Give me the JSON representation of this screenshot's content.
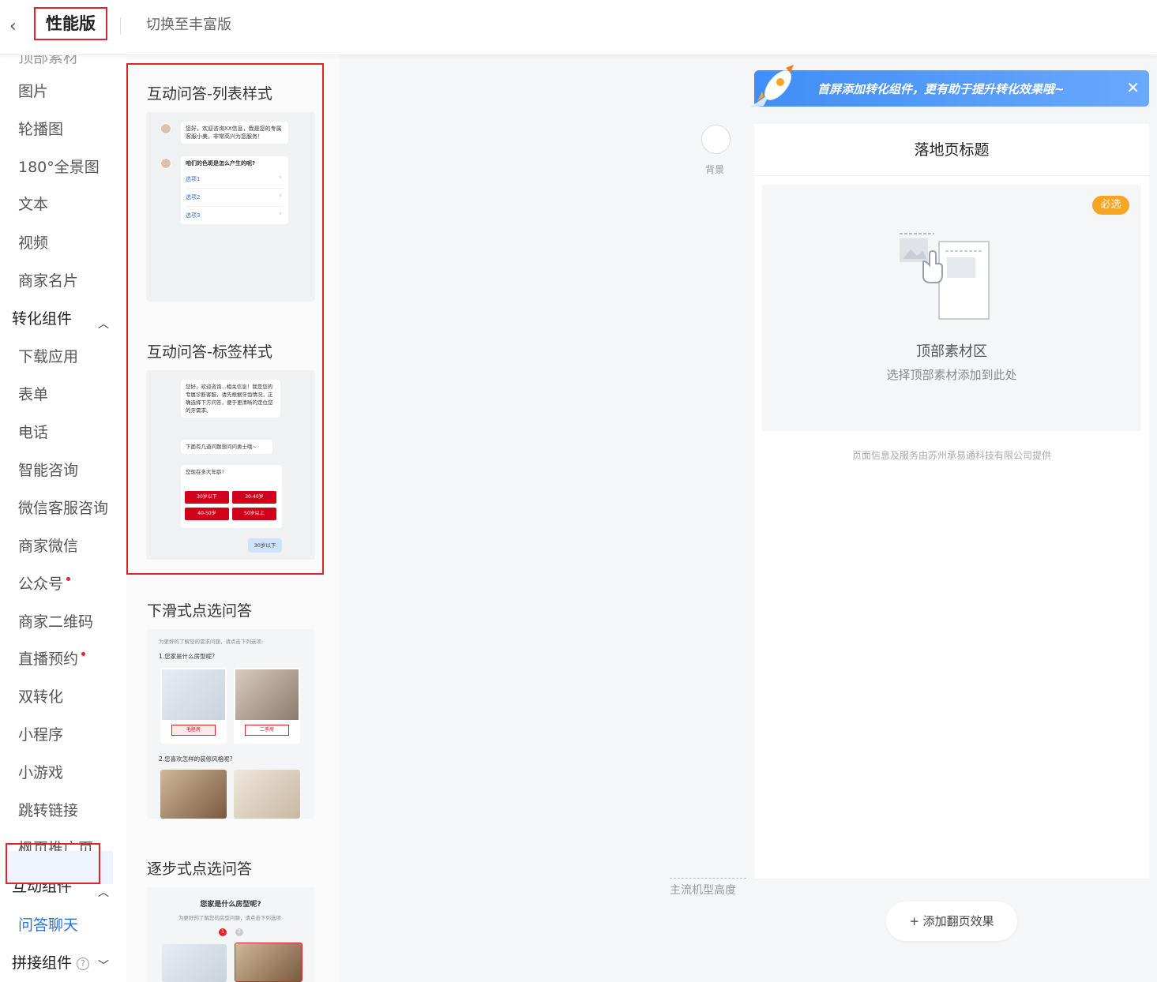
{
  "header": {
    "mode": "性能版",
    "switch_label": "切换至丰富版"
  },
  "sidebar": {
    "partial_top": "顶部素材",
    "basic_items": [
      "图片",
      "轮播图",
      "180°全景图",
      "文本",
      "视频",
      "商家名片"
    ],
    "group_conversion": "转化组件",
    "conversion_items": [
      "下载应用",
      "表单",
      "电话",
      "智能咨询",
      "微信客服咨询",
      "商家微信",
      "公众号",
      "商家二维码",
      "直播预约",
      "双转化",
      "小程序",
      "小游戏",
      "跳转链接",
      "枫页推广页"
    ],
    "group_interactive": "互动组件",
    "interactive_items": [
      "问答聊天"
    ],
    "group_splice": "拼接组件"
  },
  "panel": {
    "templates": [
      {
        "title": "互动问答-列表样式"
      },
      {
        "title": "互动问答-标签样式"
      },
      {
        "title": "下滑式点选问答"
      },
      {
        "title": "逐步式点选问答"
      }
    ],
    "list_preview": {
      "greeting": "您好，欢迎咨询XX信息，我是您的专属客服小美，非常高兴为您服务！",
      "question": "咱们的色斑是怎么产生的呢?",
      "options": [
        "选项1",
        "选项2",
        "选项3"
      ]
    },
    "tag_preview": {
      "greeting": "您好，欢迎咨询...相关信息！我是您的专属诊断客服，请先根据牙齿情况，正确选择下方问答，便于更清晰的定位您的牙需求。",
      "intro": "下面有几道问题想问问勇士哦~",
      "question": "您现在多大年龄?",
      "options": [
        "30岁以下",
        "30-40岁",
        "40-50岁",
        "50岁以上"
      ],
      "answer": "30岁以下"
    },
    "slide_preview": {
      "intro": "为更好的了解您的需求问题，请点击下列选项:",
      "q1": "1.您家是什么房型呢?",
      "q1_options": [
        "毛胚房",
        "二手房"
      ],
      "q2": "2.您喜欢怎样的装修风格呢?"
    },
    "step_preview": {
      "question": "您家是什么房型呢?",
      "intro": "为更好的了解您的房型问题，请点击下列选项:",
      "steps": [
        "1",
        "2"
      ]
    }
  },
  "canvas": {
    "background_label": "背景",
    "banner_text": "首屏添加转化组件，更有助于提升转化效果哦~",
    "banner_close": "✕",
    "page_title": "落地页标题",
    "required_badge": "必选",
    "material_title": "顶部素材区",
    "material_sub": "选择顶部素材添加到此处",
    "footer": "页面信息及服务由苏州承易通科技有限公司提供",
    "height_label": "主流机型高度",
    "add_flip": "+ 添加翻页效果"
  },
  "colors": {
    "accent": "#3f8ef7",
    "highlight_border": "#e0242c",
    "badge": "#f5a623",
    "option_red": "#d0021b"
  }
}
